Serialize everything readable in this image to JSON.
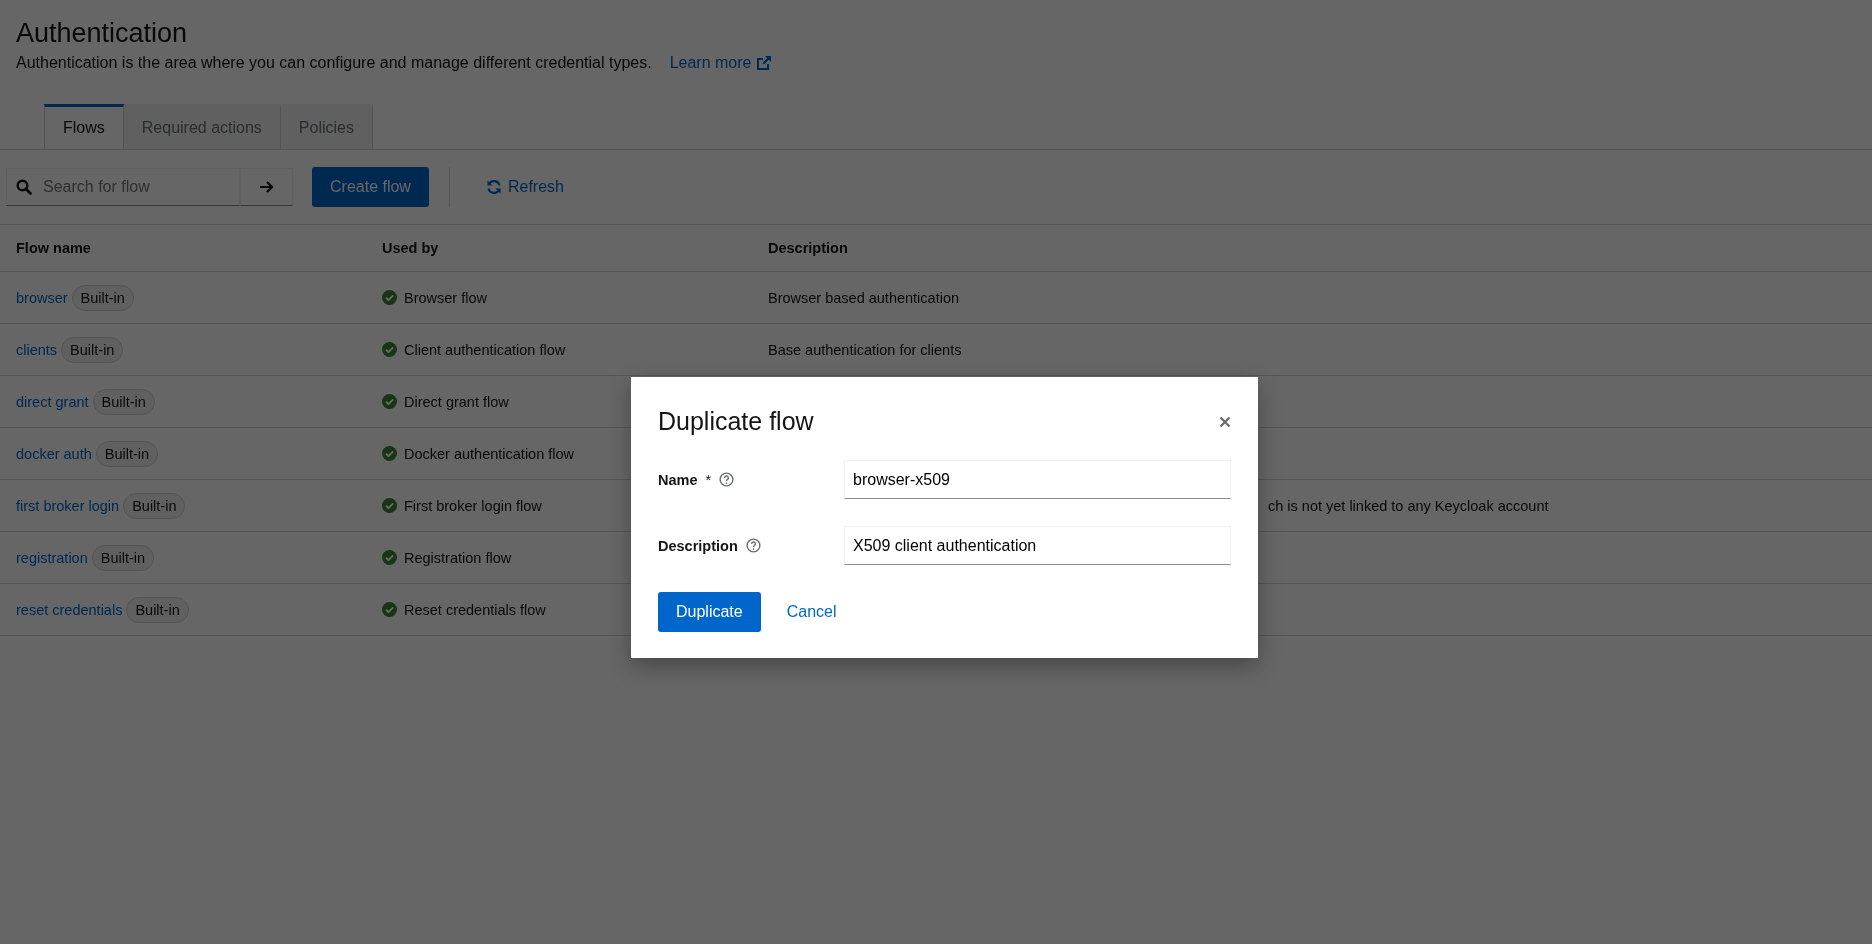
{
  "page": {
    "title": "Authentication",
    "description": "Authentication is the area where you can configure and manage different credential types.",
    "learn_more": "Learn more"
  },
  "tabs": [
    {
      "label": "Flows",
      "selected": true
    },
    {
      "label": "Required actions",
      "selected": false
    },
    {
      "label": "Policies",
      "selected": false
    }
  ],
  "toolbar": {
    "search": {
      "placeholder": "Search for flow"
    },
    "create_button": "Create flow",
    "refresh_button": "Refresh"
  },
  "table": {
    "columns": [
      "Flow name",
      "Used by",
      "Description"
    ],
    "rows": [
      {
        "name": "browser",
        "badge": "Built-in",
        "used_by": "Browser flow",
        "description": "Browser based authentication",
        "description_partly_hidden": false
      },
      {
        "name": "clients",
        "badge": "Built-in",
        "used_by": "Client authentication flow",
        "description": "Base authentication for clients",
        "description_partly_hidden": false
      },
      {
        "name": "direct grant",
        "badge": "Built-in",
        "used_by": "Direct grant flow"
      },
      {
        "name": "docker auth",
        "badge": "Built-in",
        "used_by": "Docker authentication flow"
      },
      {
        "name": "first broker login",
        "badge": "Built-in",
        "used_by": "First broker login flow",
        "description": "ch is not yet linked to any Keycloak account",
        "description_partly_hidden": true
      },
      {
        "name": "registration",
        "badge": "Built-in",
        "used_by": "Registration flow"
      },
      {
        "name": "reset credentials",
        "badge": "Built-in",
        "used_by": "Reset credentials flow"
      }
    ]
  },
  "modal": {
    "title": "Duplicate flow",
    "fields": [
      {
        "label": "Name",
        "required_mark": "*",
        "value": "browser-x509"
      },
      {
        "label": "Description",
        "value": "X509 client authentication"
      }
    ],
    "confirm_button": "Duplicate",
    "cancel_button": "Cancel"
  }
}
